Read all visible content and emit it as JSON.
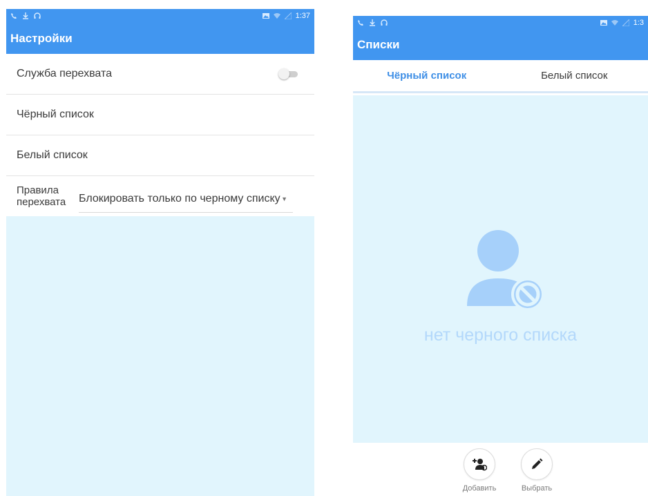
{
  "colors": {
    "accent": "#4196f0",
    "empty_bg": "#e1f5fd",
    "empty_fg": "#b3d8fb",
    "tab_active": "#3f8fe6"
  },
  "left": {
    "status_time": "1:37",
    "title": "Настройки",
    "rows": [
      {
        "label": "Служба перехвата",
        "toggle_on": false
      },
      {
        "label": "Чёрный список"
      },
      {
        "label": "Белый список"
      }
    ],
    "rule": {
      "label_line1": "Правила",
      "label_line2": "перехвата",
      "value": "Блокировать только по черному списку"
    }
  },
  "right": {
    "status_time": "1:3",
    "title": "Списки",
    "tabs": [
      {
        "label": "Чёрный список",
        "active": true
      },
      {
        "label": "Белый список",
        "active": false
      }
    ],
    "empty_text": "нет черного списка",
    "empty_icon": "person-blocked-icon",
    "actions": [
      {
        "label": "Добавить",
        "icon": "add-person-icon"
      },
      {
        "label": "Выбрать",
        "icon": "pencil-icon"
      }
    ]
  }
}
